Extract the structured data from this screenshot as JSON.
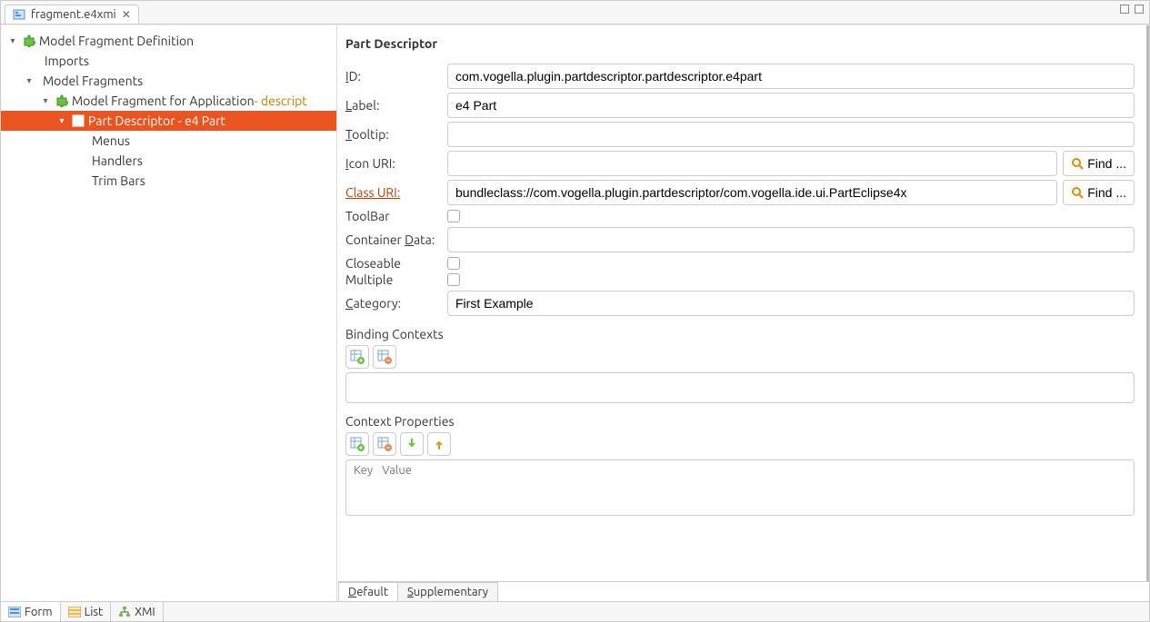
{
  "tab": {
    "title": "fragment.e4xmi"
  },
  "tree": {
    "root": "Model Fragment Definition",
    "imports": "Imports",
    "fragments": "Model Fragments",
    "fragmentForApp": "Model Fragment for Application",
    "fragmentForAppDecoration": " - descript",
    "partDescriptor": "Part Descriptor - e4 Part",
    "menus": "Menus",
    "handlers": "Handlers",
    "trimBars": "Trim Bars"
  },
  "detail": {
    "title": "Part Descriptor",
    "labels": {
      "id": "ID:",
      "label": "Label:",
      "tooltip": "Tooltip:",
      "iconUri": "Icon URI:",
      "classUri": "Class URI:",
      "toolBar": "ToolBar",
      "containerData": "Container Data:",
      "closeable": "Closeable",
      "multiple": "Multiple",
      "category": "Category:",
      "bindingContexts": "Binding Contexts",
      "contextProperties": "Context Properties",
      "key": "Key",
      "value": "Value"
    },
    "values": {
      "id": "com.vogella.plugin.partdescriptor.partdescriptor.e4part",
      "label": "e4 Part",
      "tooltip": "",
      "iconUri": "",
      "classUri": "bundleclass://com.vogella.plugin.partdescriptor/com.vogella.ide.ui.PartEclipse4x",
      "containerData": "",
      "category": "First Example"
    },
    "buttons": {
      "find": "Find ..."
    },
    "subtabs": {
      "default": "Default",
      "supplementary": "Supplementary"
    }
  },
  "footer": {
    "form": "Form",
    "list": "List",
    "xmi": "XMI"
  }
}
